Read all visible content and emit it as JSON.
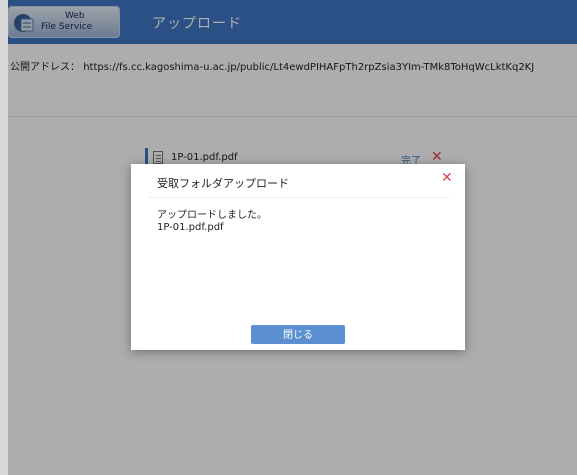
{
  "header": {
    "logo_line1": "Web",
    "logo_line2": "File Service",
    "title": "アップロード"
  },
  "address": {
    "label": "公開アドレス：",
    "url": "https://fs.cc.kagoshima-u.ac.jp/public/Lt4ewdPIHAFpTh2rpZsia3YIm-TMk8ToHqWcLktKq2KJ"
  },
  "file_row": {
    "name": "1P-01.pdf.pdf",
    "status": "完了",
    "remove_symbol": "✕"
  },
  "modal": {
    "title": "受取フォルダアップロード",
    "close_symbol": "✕",
    "message": "アップロードしました。",
    "file_name": "1P-01.pdf.pdf",
    "close_button": "閉じる"
  },
  "colors": {
    "header_bg": "#3f77c6",
    "accent": "#5b8fd2",
    "danger": "#e0434e"
  }
}
